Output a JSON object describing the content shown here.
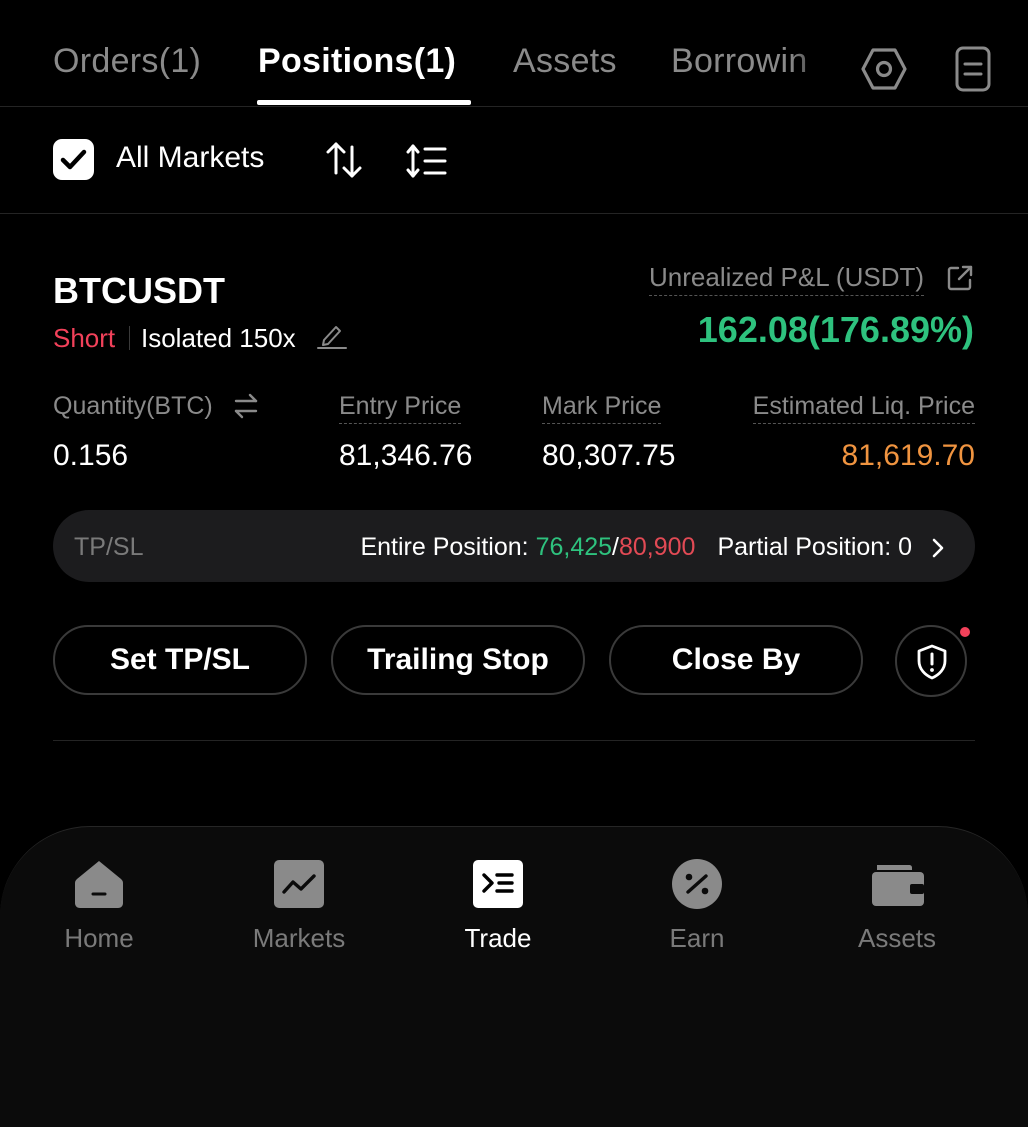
{
  "tabs": [
    {
      "label": "Orders(1)"
    },
    {
      "label": "Positions(1)"
    },
    {
      "label": "Assets"
    },
    {
      "label": "Borrowin"
    }
  ],
  "icons": {
    "settings": "hexagon-settings-icon",
    "records": "document-list-icon",
    "sort": "sort-arrows-icon",
    "filter": "list-filter-icon"
  },
  "filter": {
    "checked": true,
    "label": "All Markets"
  },
  "position": {
    "symbol": "BTCUSDT",
    "side": "Short",
    "margin_mode": "Isolated 150x",
    "pnl_label": "Unrealized P&L (USDT)",
    "pnl_value": "162.08(176.89%)",
    "stats": [
      {
        "label": "Quantity(BTC)",
        "value": "0.156"
      },
      {
        "label": "Entry Price",
        "value": "81,346.76"
      },
      {
        "label": "Mark Price",
        "value": "80,307.75"
      },
      {
        "label": "Estimated Liq. Price",
        "value": "81,619.70"
      }
    ],
    "tpsl": {
      "label": "TP/SL",
      "entire_label": "Entire Position: ",
      "tp": "76,425",
      "slash": "/",
      "sl": "80,900",
      "partial": "Partial Position: 0"
    },
    "actions": [
      {
        "label": "Set TP/SL"
      },
      {
        "label": "Trailing Stop"
      },
      {
        "label": "Close By"
      }
    ]
  },
  "nav": [
    {
      "label": "Home",
      "icon": "home-icon"
    },
    {
      "label": "Markets",
      "icon": "chart-icon"
    },
    {
      "label": "Trade",
      "icon": "trade-icon",
      "active": true
    },
    {
      "label": "Earn",
      "icon": "percent-icon"
    },
    {
      "label": "Assets",
      "icon": "wallet-icon"
    }
  ],
  "colors": {
    "background": "#000000",
    "profit": "#2ec27e",
    "loss": "#e24a55",
    "short": "#f2415a",
    "liquidation": "#f09440"
  }
}
